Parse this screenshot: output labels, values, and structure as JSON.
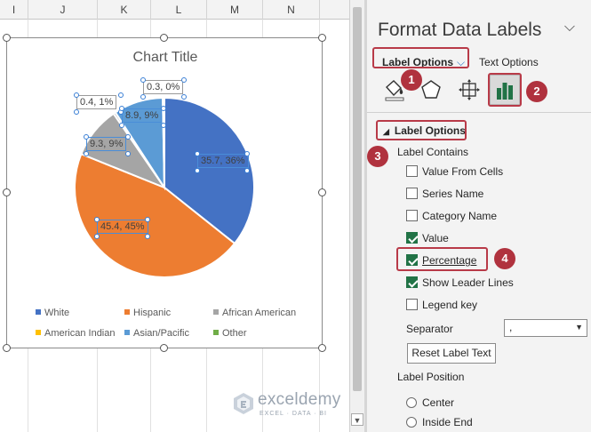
{
  "sheet": {
    "columns": [
      "I",
      "J",
      "K",
      "L",
      "M",
      "N"
    ]
  },
  "chart": {
    "title": "Chart Title",
    "labels": {
      "african_american": "0.4, 1%",
      "american_indian": "0.3, 0%",
      "asian_pacific": "8.9, 9%",
      "other": "9.3, 9%",
      "white": "35.7, 36%",
      "hispanic": "45.4, 45%"
    },
    "legend": [
      "White",
      "Hispanic",
      "African American",
      "American Indian",
      "Asian/Pacific",
      "Other"
    ]
  },
  "chart_data": {
    "type": "pie",
    "title": "Chart Title",
    "categories": [
      "White",
      "Hispanic",
      "African American",
      "American Indian",
      "Asian/Pacific",
      "Other"
    ],
    "slices": [
      {
        "name": "White",
        "value": 35.7,
        "percent_label": "36%",
        "color": "#4472c4"
      },
      {
        "name": "Hispanic",
        "value": 45.4,
        "percent_label": "45%",
        "color": "#ed7d31"
      },
      {
        "name": "Other",
        "value": 9.3,
        "percent_label": "9%",
        "color": "#a5a5a5"
      },
      {
        "name": "African American",
        "value": 0.4,
        "percent_label": "1%",
        "color": "#a5a5a5"
      },
      {
        "name": "Asian/Pacific",
        "value": 8.9,
        "percent_label": "9%",
        "color": "#5b9bd5"
      },
      {
        "name": "American Indian",
        "value": 0.3,
        "percent_label": "0%",
        "color": "#ffc000"
      }
    ],
    "legend_position": "bottom",
    "legend_colors": [
      "#4472c4",
      "#ed7d31",
      "#a5a5a5",
      "#ffc000",
      "#5b9bd5",
      "#70ad47"
    ]
  },
  "pane": {
    "title": "Format Data Labels",
    "tab_label_options": "Label Options",
    "tab_text_options": "Text Options",
    "section_title": "Label Options",
    "label_contains": "Label Contains",
    "options": [
      {
        "label": "Value From Cells",
        "checked": false
      },
      {
        "label": "Series Name",
        "checked": false
      },
      {
        "label": "Category Name",
        "checked": false
      },
      {
        "label": "Value",
        "checked": true
      },
      {
        "label": "Percentage",
        "checked": true
      },
      {
        "label": "Show Leader Lines",
        "checked": true
      },
      {
        "label": "Legend key",
        "checked": false
      }
    ],
    "separator_label": "Separator",
    "separator_value": ",",
    "reset_button": "Reset Label Text",
    "label_position": "Label Position",
    "positions": [
      "Center",
      "Inside End"
    ]
  },
  "badges": [
    "1",
    "2",
    "3",
    "4"
  ],
  "watermark": {
    "name": "exceldemy",
    "tagline": "EXCEL · DATA · BI"
  },
  "colors": {
    "accent_red": "#b83a48",
    "excel_green": "#217346",
    "selection_blue": "#4a8dd8"
  }
}
